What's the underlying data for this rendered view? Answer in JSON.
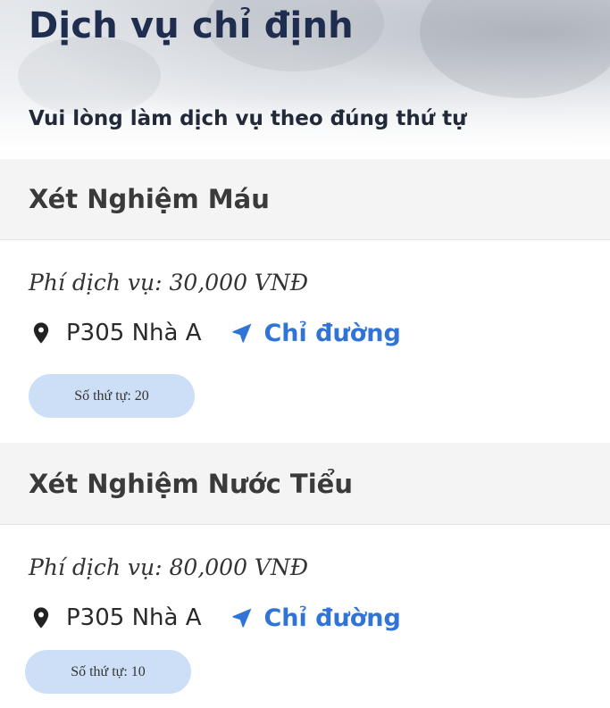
{
  "header": {
    "title": "Dịch vụ chỉ định",
    "subtitle": "Vui lòng làm dịch vụ theo đúng thứ tự"
  },
  "services": [
    {
      "name": "Xét Nghiệm Máu",
      "fee": "Phí dịch vụ: 30,000 VNĐ",
      "room": "P305 Nhà A",
      "directions_label": "Chỉ đường",
      "queue": "Số thứ tự: 20"
    },
    {
      "name": "Xét Nghiệm Nước Tiểu",
      "fee": "Phí dịch vụ: 80,000 VNĐ",
      "room": "P305 Nhà A",
      "directions_label": "Chỉ đường",
      "queue": "Số thứ tự: 10"
    }
  ],
  "icons": {
    "location": "map-pin-icon",
    "directions": "navigation-arrow-icon"
  },
  "colors": {
    "title": "#1f2d4f",
    "link": "#2f74d6",
    "pill": "#cddff7",
    "section_header_bg": "#f4f4f4"
  }
}
